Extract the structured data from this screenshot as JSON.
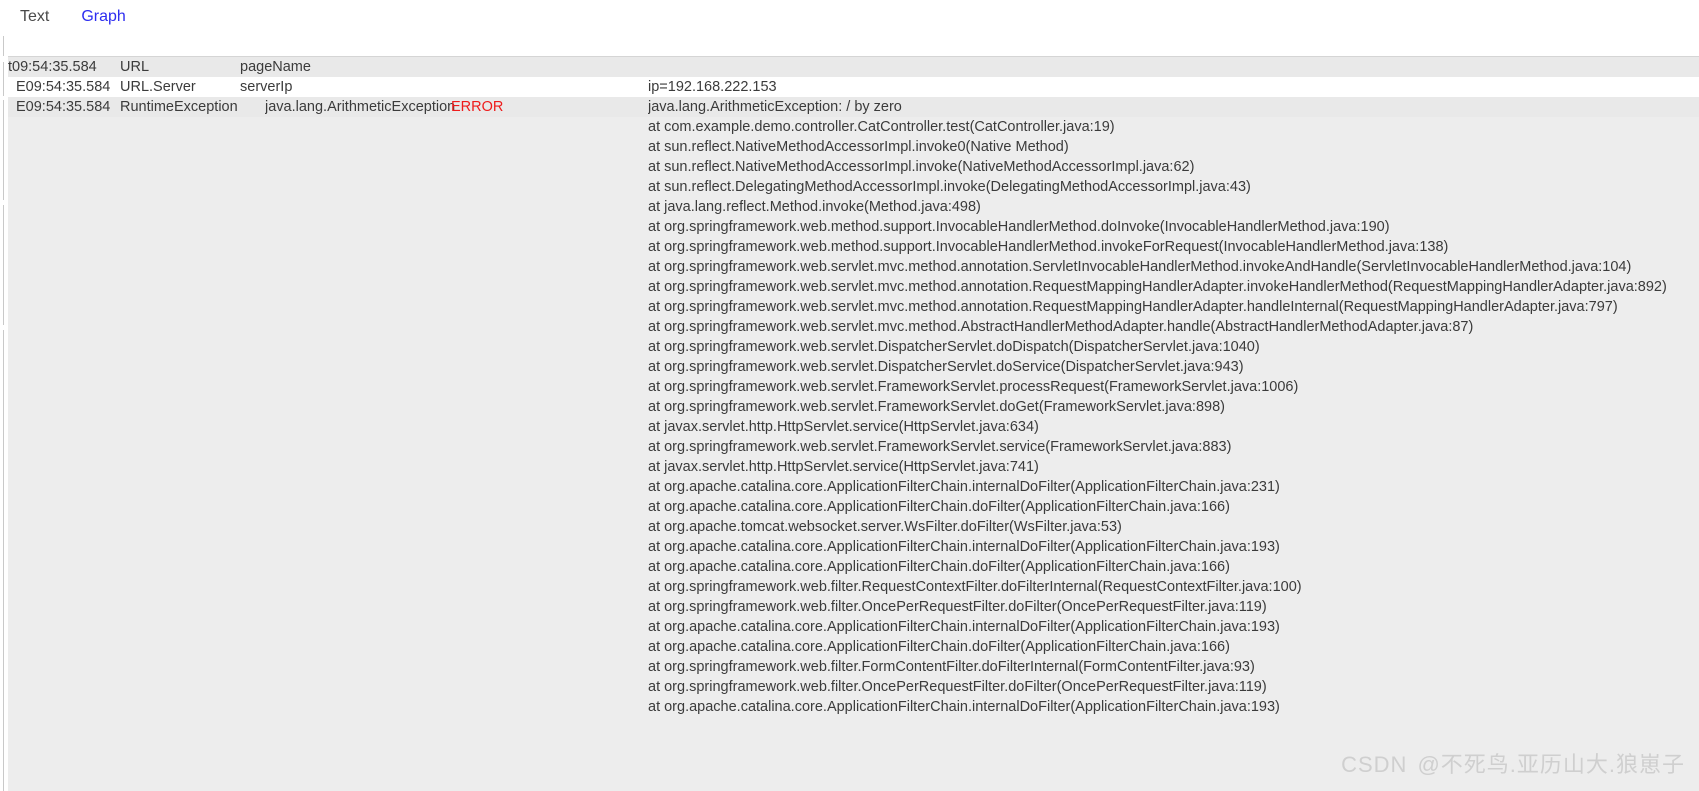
{
  "tabs": [
    {
      "label": "Text",
      "active": false
    },
    {
      "label": "Graph",
      "active": true
    }
  ],
  "colors": {
    "accent": "#2d2df0",
    "error": "#ee1c1c",
    "row_gray": "#e9e9e9",
    "row_white": "#ffffff",
    "body_bg": "#ededed",
    "text": "#3b3b3b",
    "watermark": "#cfcfcf"
  },
  "rows": [
    {
      "shade": "gray",
      "time": "t09:54:35.584",
      "col_a": "URL",
      "col_b": "pageName",
      "message": ""
    },
    {
      "shade": "white",
      "time": "E09:54:35.584",
      "col_a": "URL.Server",
      "col_b": "serverIp",
      "message": "ip=192.168.222.153"
    },
    {
      "shade": "gray",
      "time": "E09:54:35.584",
      "col_a": "RuntimeException",
      "col_b": "java.lang.ArithmeticException",
      "level": "ERROR",
      "message": "java.lang.ArithmeticException: / by zero"
    }
  ],
  "stacktrace": [
    "at com.example.demo.controller.CatController.test(CatController.java:19)",
    "at sun.reflect.NativeMethodAccessorImpl.invoke0(Native Method)",
    "at sun.reflect.NativeMethodAccessorImpl.invoke(NativeMethodAccessorImpl.java:62)",
    "at sun.reflect.DelegatingMethodAccessorImpl.invoke(DelegatingMethodAccessorImpl.java:43)",
    "at java.lang.reflect.Method.invoke(Method.java:498)",
    "at org.springframework.web.method.support.InvocableHandlerMethod.doInvoke(InvocableHandlerMethod.java:190)",
    "at org.springframework.web.method.support.InvocableHandlerMethod.invokeForRequest(InvocableHandlerMethod.java:138)",
    "at org.springframework.web.servlet.mvc.method.annotation.ServletInvocableHandlerMethod.invokeAndHandle(ServletInvocableHandlerMethod.java:104)",
    "at org.springframework.web.servlet.mvc.method.annotation.RequestMappingHandlerAdapter.invokeHandlerMethod(RequestMappingHandlerAdapter.java:892)",
    "at org.springframework.web.servlet.mvc.method.annotation.RequestMappingHandlerAdapter.handleInternal(RequestMappingHandlerAdapter.java:797)",
    "at org.springframework.web.servlet.mvc.method.AbstractHandlerMethodAdapter.handle(AbstractHandlerMethodAdapter.java:87)",
    "at org.springframework.web.servlet.DispatcherServlet.doDispatch(DispatcherServlet.java:1040)",
    "at org.springframework.web.servlet.DispatcherServlet.doService(DispatcherServlet.java:943)",
    "at org.springframework.web.servlet.FrameworkServlet.processRequest(FrameworkServlet.java:1006)",
    "at org.springframework.web.servlet.FrameworkServlet.doGet(FrameworkServlet.java:898)",
    "at javax.servlet.http.HttpServlet.service(HttpServlet.java:634)",
    "at org.springframework.web.servlet.FrameworkServlet.service(FrameworkServlet.java:883)",
    "at javax.servlet.http.HttpServlet.service(HttpServlet.java:741)",
    "at org.apache.catalina.core.ApplicationFilterChain.internalDoFilter(ApplicationFilterChain.java:231)",
    "at org.apache.catalina.core.ApplicationFilterChain.doFilter(ApplicationFilterChain.java:166)",
    "at org.apache.tomcat.websocket.server.WsFilter.doFilter(WsFilter.java:53)",
    "at org.apache.catalina.core.ApplicationFilterChain.internalDoFilter(ApplicationFilterChain.java:193)",
    "at org.apache.catalina.core.ApplicationFilterChain.doFilter(ApplicationFilterChain.java:166)",
    "at org.springframework.web.filter.RequestContextFilter.doFilterInternal(RequestContextFilter.java:100)",
    "at org.springframework.web.filter.OncePerRequestFilter.doFilter(OncePerRequestFilter.java:119)",
    "at org.apache.catalina.core.ApplicationFilterChain.internalDoFilter(ApplicationFilterChain.java:193)",
    "at org.apache.catalina.core.ApplicationFilterChain.doFilter(ApplicationFilterChain.java:166)",
    "at org.springframework.web.filter.FormContentFilter.doFilterInternal(FormContentFilter.java:93)",
    "at org.springframework.web.filter.OncePerRequestFilter.doFilter(OncePerRequestFilter.java:119)",
    "at org.apache.catalina.core.ApplicationFilterChain.internalDoFilter(ApplicationFilterChain.java:193)"
  ],
  "watermark": {
    "brand": "CSDN",
    "user": "@不死鸟.亚历山大.狼崽子"
  }
}
